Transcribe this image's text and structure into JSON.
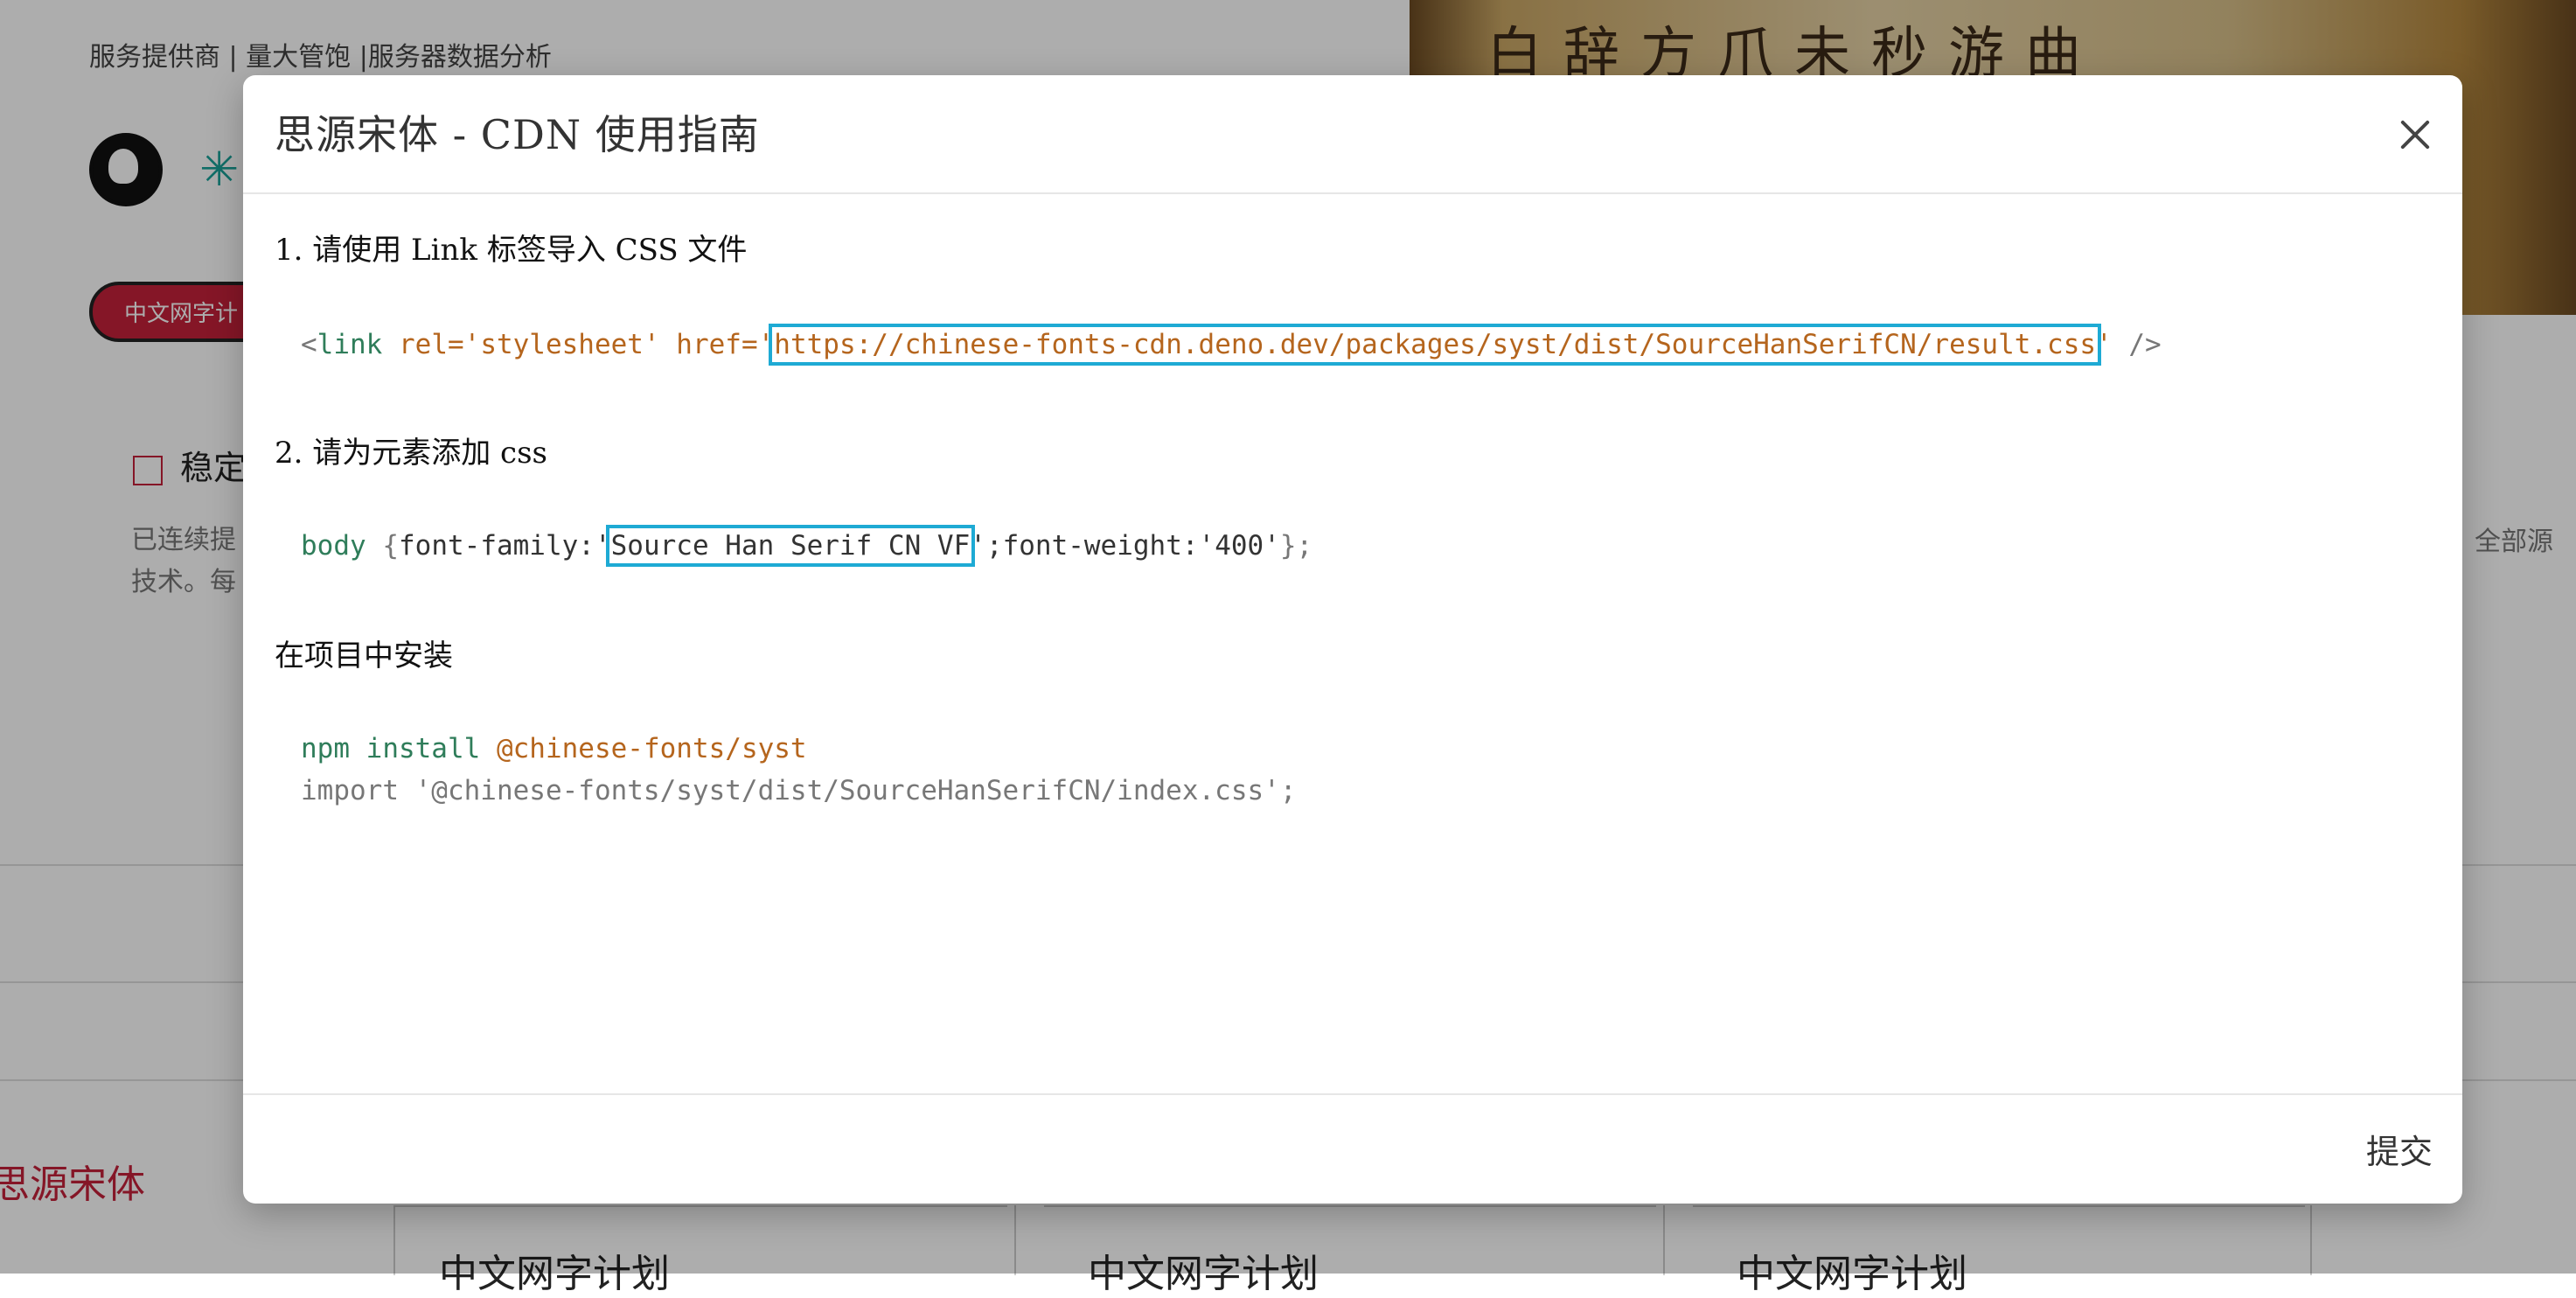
{
  "background": {
    "topnav": "服务提供商 | 量大管饱 |服务器数据分析",
    "chip": "中文网字计",
    "stable_label": "稳定",
    "paragraph_line1": "已连续提",
    "paragraph_line2": "技术。每",
    "paragraph_right": "全部源",
    "photo_glyphs": "白辞方爪未秒游曲",
    "bottom_title": "思源宋体",
    "cards": [
      "中文网字计划",
      "中文网字计划",
      "中文网字计划"
    ]
  },
  "modal": {
    "title": "思源宋体 - CDN 使用指南",
    "step1": "1. 请使用 Link 标签导入 CSS 文件",
    "link_code": {
      "open": "<",
      "tag": "link",
      "rel_attr": "rel=",
      "rel_val": "'stylesheet'",
      "href_attr": "href=",
      "quote_open": "'",
      "url": "https://chinese-fonts-cdn.deno.dev/packages/syst/dist/SourceHanSerifCN/result.css",
      "quote_close": "'",
      "close": "/>"
    },
    "step2": "2. 请为元素添加 css",
    "css_code": {
      "selector": "body",
      "brace_open": "{",
      "prop_prefix": "font-family:'",
      "font_name": "Source Han Serif CN VF",
      "prop_suffix": "';font-weight:'400'",
      "brace_close": "};"
    },
    "step3": "在项目中安装",
    "npm": {
      "cmd": "npm install",
      "pkg": "@chinese-fonts/syst",
      "import_line": "import '@chinese-fonts/syst/dist/SourceHanSerifCN/index.css';"
    },
    "submit": "提交"
  }
}
